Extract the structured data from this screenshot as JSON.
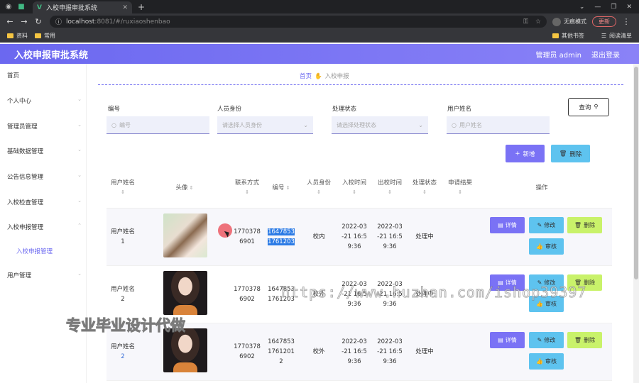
{
  "browser": {
    "tab_title": "入校申报审批系统",
    "url_host": "localhost",
    "url_rest": ":8081/#/ruxiaoshenbao",
    "incognito_label": "无痕模式",
    "update_label": "更新",
    "bookmarks": [
      "资料",
      "常用"
    ],
    "bookmarks_right": [
      "其他书签",
      "阅读清单"
    ]
  },
  "header": {
    "title": "入校申报审批系统",
    "user": "管理员 admin",
    "logout": "退出登录",
    "gradient_from": "#6b68f0",
    "gradient_to": "#8a82f7"
  },
  "sidebar": {
    "items": [
      {
        "label": "首页"
      },
      {
        "label": "个人中心"
      },
      {
        "label": "管理员管理"
      },
      {
        "label": "基础数据管理"
      },
      {
        "label": "公告信息管理"
      },
      {
        "label": "入校检查管理"
      },
      {
        "label": "入校申报管理"
      },
      {
        "label": "入校申报管理"
      },
      {
        "label": "用户管理"
      }
    ]
  },
  "breadcrumb": {
    "home": "首页",
    "current": "入校申报"
  },
  "filters": {
    "number_label": "编号",
    "number_placeholder": "编号",
    "identity_label": "人员身份",
    "identity_placeholder": "请选择人员身份",
    "status_label": "处理状态",
    "status_placeholder": "请选择处理状态",
    "username_label": "用户姓名",
    "username_placeholder": "用户姓名",
    "search_button": "查询"
  },
  "actions": {
    "add": "新增",
    "delete": "删除"
  },
  "table": {
    "headers": {
      "username": "用户姓名",
      "avatar": "头像",
      "phone": "联系方式",
      "number": "编号",
      "identity": "人员身份",
      "in_time": "入校时间",
      "out_time": "出校时间",
      "status": "处理状态",
      "result": "申请结果",
      "ops": "操作"
    },
    "rows": [
      {
        "name": "用户姓名",
        "name_idx": "1",
        "phone1": "1770378",
        "phone2": "6901",
        "num1": "1647853",
        "num2": "1761203",
        "num3": "",
        "identity": "校内",
        "in1": "2022-03",
        "in2": "-21 16:5",
        "in3": "9:36",
        "out1": "2022-03",
        "out2": "-21 16:5",
        "out3": "9:36",
        "status": "处理中"
      },
      {
        "name": "用户姓名",
        "name_idx": "2",
        "phone1": "1770378",
        "phone2": "6902",
        "num1": "1647853",
        "num2": "1761203",
        "num3": "",
        "identity": "校外",
        "in1": "2022-03",
        "in2": "-21 16:5",
        "in3": "9:36",
        "out1": "2022-03",
        "out2": "-21 16:5",
        "out3": "9:36",
        "status": "处理中"
      },
      {
        "name": "用户姓名",
        "name_idx": "2",
        "phone1": "1770378",
        "phone2": "6902",
        "num1": "1647853",
        "num2": "1761201",
        "num3": "2",
        "identity": "校外",
        "in1": "2022-03",
        "in2": "-21 16:5",
        "in3": "9:36",
        "out1": "2022-03",
        "out2": "-21 16:5",
        "out3": "9:36",
        "status": "处理中"
      }
    ],
    "op_labels": {
      "detail": "详情",
      "edit": "修改",
      "delete": "删除",
      "audit": "审核"
    }
  },
  "watermarks": {
    "url": "https://www.huzhan.com/ishop39397",
    "text": "专业毕业设计代做"
  }
}
